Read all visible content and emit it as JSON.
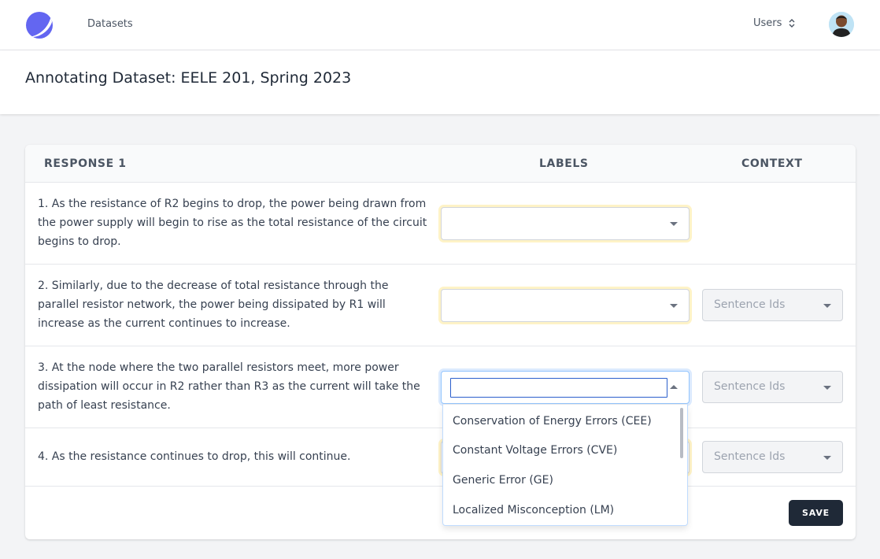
{
  "nav": {
    "datasets_label": "Datasets",
    "users_label": "Users"
  },
  "page": {
    "title": "Annotating Dataset: EELE 201, Spring 2023"
  },
  "table": {
    "headers": {
      "response": "RESPONSE 1",
      "labels": "LABELS",
      "context": "CONTEXT"
    },
    "rows": [
      {
        "text": "1. As the resistance of R2 begins to drop, the power being drawn from the power supply will begin to rise as the total resistance of the circuit begins to drop."
      },
      {
        "text": "2. Similarly, due to the decrease of total resistance through the parallel resistor network, the power being dissipated by R1 will increase as the current continues to increase.",
        "context_placeholder": "Sentence Ids"
      },
      {
        "text": "3. At the node where the two parallel resistors meet, more power dissipation will occur in R2 rather than R3 as the current will take the path of least resistance.",
        "context_placeholder": "Sentence Ids",
        "search_value": ""
      },
      {
        "text": "4. As the resistance continues to drop, this will continue.",
        "context_placeholder": "Sentence Ids"
      }
    ]
  },
  "dropdown": {
    "options": [
      "Conservation of Energy Errors (CEE)",
      "Constant Voltage Errors (CVE)",
      "Generic Error (GE)",
      "Localized Misconception (LM)"
    ]
  },
  "actions": {
    "save_label": "SAVE"
  },
  "colors": {
    "primary_dark": "#1f2937",
    "logo_blue": "#6366f1",
    "focus_blue": "#2b5fcc",
    "highlight_yellow": "#fef3c7"
  },
  "icons": {
    "logo": "logo-icon",
    "users_toggle": "chevron-up-down-icon",
    "select_caret": "caret-down-icon",
    "open_caret": "caret-up-icon"
  }
}
